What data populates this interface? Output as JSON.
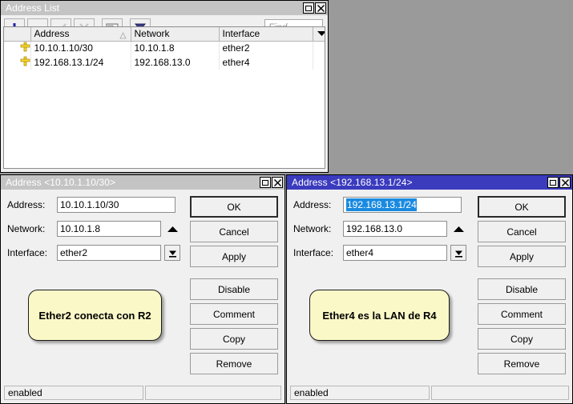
{
  "desktop": {
    "background": "#9a9a9a"
  },
  "address_list_window": {
    "title": "Address List",
    "titlebar_state": "inactive",
    "buttons": {
      "maximize": "maximize-button",
      "close": "close-button"
    },
    "toolbar": {
      "add": "+",
      "remove": "-",
      "enable": "check",
      "disable": "cross",
      "comment": "comment",
      "filter": "filter"
    },
    "find": {
      "placeholder": "Find",
      "value": ""
    },
    "columns": [
      "",
      "Address",
      "Network",
      "Interface",
      ""
    ],
    "sort_column": "Address",
    "rows": [
      {
        "flag": "address-icon",
        "address": "10.10.1.10/30",
        "network": "10.10.1.8",
        "interface": "ether2"
      },
      {
        "flag": "address-icon",
        "address": "192.168.13.1/24",
        "network": "192.168.13.0",
        "interface": "ether4"
      }
    ]
  },
  "dialog_left": {
    "title": "Address <10.10.1.10/30>",
    "titlebar_state": "inactive",
    "fields": {
      "address_label": "Address:",
      "address_value": "10.10.1.10/30",
      "network_label": "Network:",
      "network_value": "10.10.1.8",
      "interface_label": "Interface:",
      "interface_value": "ether2"
    },
    "buttons": {
      "ok": "OK",
      "cancel": "Cancel",
      "apply": "Apply",
      "disable": "Disable",
      "comment": "Comment",
      "copy": "Copy",
      "remove": "Remove"
    },
    "callout": "Ether2 conecta con R2",
    "status": "enabled"
  },
  "dialog_right": {
    "title": "Address <192.168.13.1/24>",
    "titlebar_state": "active",
    "titlebar_color": "#3b3bbe",
    "fields": {
      "address_label": "Address:",
      "address_value": "192.168.13.1/24",
      "address_selected": true,
      "selection_color": "#1a8ae0",
      "network_label": "Network:",
      "network_value": "192.168.13.0",
      "interface_label": "Interface:",
      "interface_value": "ether4"
    },
    "buttons": {
      "ok": "OK",
      "cancel": "Cancel",
      "apply": "Apply",
      "disable": "Disable",
      "comment": "Comment",
      "copy": "Copy",
      "remove": "Remove"
    },
    "callout": "Ether4 es la LAN de R4",
    "status": "enabled"
  }
}
